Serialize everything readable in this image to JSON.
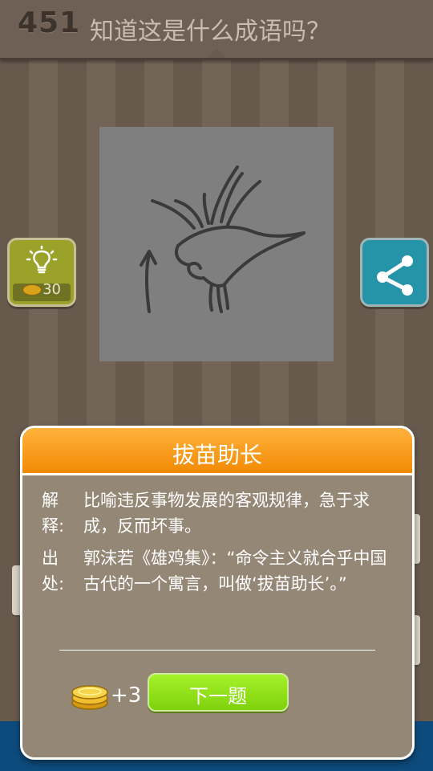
{
  "header": {
    "level": "451",
    "question": "知道这是什么成语吗？"
  },
  "hint": {
    "cost": "30",
    "icon": "lightbulb-icon",
    "color": "#9ba22a"
  },
  "share": {
    "icon": "share-icon",
    "color": "#2593a8"
  },
  "banner": {
    "text": "***************"
  },
  "popup": {
    "title": "拔苗助长",
    "explain_label": "解释:",
    "explain_text": "比喻违反事物发展的客观规律，急于求成，反而坏事。",
    "source_label": "出处:",
    "source_text": "郭沫若《雄鸡集》：“命令主义就合乎中国古代的一个寓言，叫做‘拔苗助长’。”",
    "reward": "+3",
    "next_label": "下一题",
    "accent": "#f28a05",
    "button_color": "#7fd10c"
  }
}
